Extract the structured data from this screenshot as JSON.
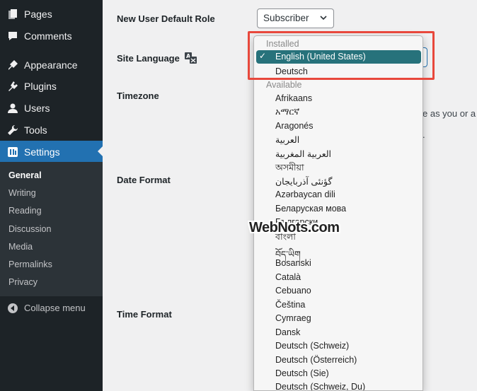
{
  "sidebar": {
    "items": [
      {
        "label": "Pages",
        "icon": "pages-icon"
      },
      {
        "label": "Comments",
        "icon": "comments-icon"
      },
      {
        "label": "Appearance",
        "icon": "appearance-icon"
      },
      {
        "label": "Plugins",
        "icon": "plugins-icon"
      },
      {
        "label": "Users",
        "icon": "users-icon"
      },
      {
        "label": "Tools",
        "icon": "tools-icon"
      },
      {
        "label": "Settings",
        "icon": "settings-icon"
      }
    ],
    "submenu": [
      "General",
      "Writing",
      "Reading",
      "Discussion",
      "Media",
      "Permalinks",
      "Privacy"
    ],
    "collapse_label": "Collapse menu"
  },
  "main": {
    "rows": {
      "new_user_role": "New User Default Role",
      "site_language": "Site Language",
      "timezone": "Timezone",
      "date_format": "Date Format",
      "time_format": "Time Format"
    },
    "role_value": "Subscriber",
    "timezone_desc_fragment": "e as you or a",
    "timezone_desc_end": "."
  },
  "dropdown": {
    "installed_label": "Installed",
    "selected": "English (United States)",
    "installed": [
      "Deutsch"
    ],
    "available_label": "Available",
    "available": [
      "Afrikaans",
      "አማርኛ",
      "Aragonés",
      "العربية",
      "العربية المغربية",
      "অসমীয়া",
      "گؤنئی آذربایجان",
      "Azərbaycan dili",
      "Беларуская мова",
      "Български",
      "বাংলা",
      "བོད་ཡིག",
      "Bosanski",
      "Català",
      "Cebuano",
      "Čeština",
      "Cymraeg",
      "Dansk",
      "Deutsch (Schweiz)",
      "Deutsch (Österreich)",
      "Deutsch (Sie)",
      "Deutsch (Schweiz, Du)"
    ]
  },
  "watermark": "WebNots.com",
  "colors": {
    "sidebar_bg": "#1d2327",
    "active": "#2271b1",
    "selected_option": "#27727b",
    "highlight": "#e8483c"
  }
}
